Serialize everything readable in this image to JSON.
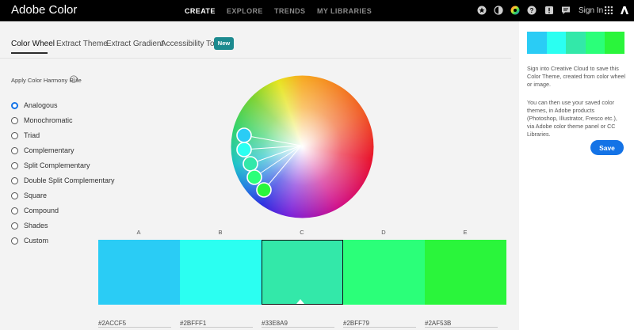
{
  "brand": "Adobe Color",
  "nav": [
    {
      "label": "CREATE",
      "active": true
    },
    {
      "label": "EXPLORE",
      "active": false
    },
    {
      "label": "TRENDS",
      "active": false
    },
    {
      "label": "MY LIBRARIES",
      "active": false
    }
  ],
  "top_icons": [
    "star-badge-icon",
    "contrast-icon",
    "color-wheel-icon",
    "help-icon",
    "alert-icon",
    "comment-icon"
  ],
  "signin": "Sign In",
  "tabs": [
    {
      "label": "Color Wheel",
      "active": true
    },
    {
      "label": "Extract Theme",
      "active": false
    },
    {
      "label": "Extract Gradient",
      "active": false
    },
    {
      "label": "Accessibility Tools",
      "active": false
    }
  ],
  "new_badge": "New",
  "harmony": {
    "title": "Apply Color Harmony Rule",
    "selected": "Analogous",
    "options": [
      "Analogous",
      "Monochromatic",
      "Triad",
      "Complementary",
      "Split Complementary",
      "Double Split Complementary",
      "Square",
      "Compound",
      "Shades",
      "Custom"
    ]
  },
  "swatches": [
    {
      "letter": "A",
      "hex": "#2ACCF5",
      "selected": false
    },
    {
      "letter": "B",
      "hex": "#2BFFF1",
      "selected": false
    },
    {
      "letter": "C",
      "hex": "#33E8A9",
      "selected": true
    },
    {
      "letter": "D",
      "hex": "#2BFF79",
      "selected": false
    },
    {
      "letter": "E",
      "hex": "#2AF53B",
      "selected": false
    }
  ],
  "right_panel": {
    "text1": "Sign into Creative Cloud to save this Color Theme, created from color wheel or image.",
    "text2": "You can then use your saved color themes, in Adobe products (Photoshop, Illustrator, Fresco etc.), via Adobe color theme panel or CC Libraries.",
    "save_label": "Save"
  },
  "colors": {
    "accent": "#1473e6",
    "badge": "#1c8a8f",
    "topbar": "#000000"
  }
}
